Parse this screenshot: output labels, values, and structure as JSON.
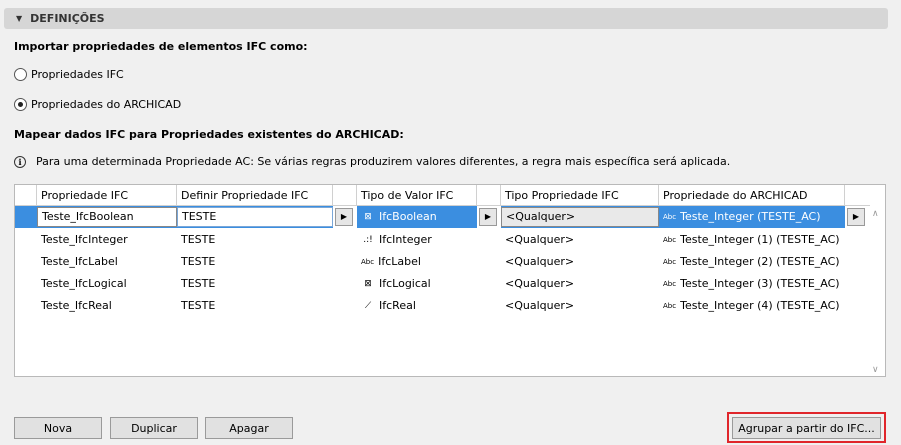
{
  "section": {
    "title": "DEFINIÇÕES"
  },
  "import": {
    "label": "Importar propriedades de elementos IFC como:",
    "options": [
      {
        "label": "Propriedades IFC",
        "selected": false
      },
      {
        "label": "Propriedades do ARCHICAD",
        "selected": true
      }
    ]
  },
  "map": {
    "label": "Mapear dados IFC para Propriedades existentes do ARCHICAD:",
    "info": "Para uma determinada Propriedade AC: Se várias regras produzirem valores diferentes, a regra mais específica será aplicada."
  },
  "table": {
    "headers": [
      "Propriedade IFC",
      "Definir Propriedade IFC",
      "Tipo de Valor IFC",
      "Tipo Propriedade IFC",
      "Propriedade do ARCHICAD"
    ],
    "rows": [
      {
        "prop": "Teste_IfcBoolean",
        "define": "TESTE",
        "vtype": "IfcBoolean",
        "vicon": "checkbox-x-icon",
        "ptype": "<Qualquer>",
        "ac": "Teste_Integer (TESTE_AC)"
      },
      {
        "prop": "Teste_IfcInteger",
        "define": "TESTE",
        "vtype": "IfcInteger",
        "vicon": "integer-icon",
        "ptype": "<Qualquer>",
        "ac": "Teste_Integer (1) (TESTE_AC)"
      },
      {
        "prop": "Teste_IfcLabel",
        "define": "TESTE",
        "vtype": "IfcLabel",
        "vicon": "abc-icon",
        "ptype": "<Qualquer>",
        "ac": "Teste_Integer (2) (TESTE_AC)"
      },
      {
        "prop": "Teste_IfcLogical",
        "define": "TESTE",
        "vtype": "IfcLogical",
        "vicon": "checkbox-x-icon",
        "ptype": "<Qualquer>",
        "ac": "Teste_Integer (3) (TESTE_AC)"
      },
      {
        "prop": "Teste_IfcReal",
        "define": "TESTE",
        "vtype": "IfcReal",
        "vicon": "real-number-icon",
        "ptype": "<Qualquer>",
        "ac": "Teste_Integer (4) (TESTE_AC)"
      }
    ],
    "abc_glyph": "Abc"
  },
  "buttons": {
    "new": "Nova",
    "duplicate": "Duplicar",
    "delete": "Apagar",
    "group": "Agrupar a partir do IFC..."
  },
  "colors": {
    "selection": "#3b8ee0",
    "highlight_frame": "#e0262b"
  }
}
